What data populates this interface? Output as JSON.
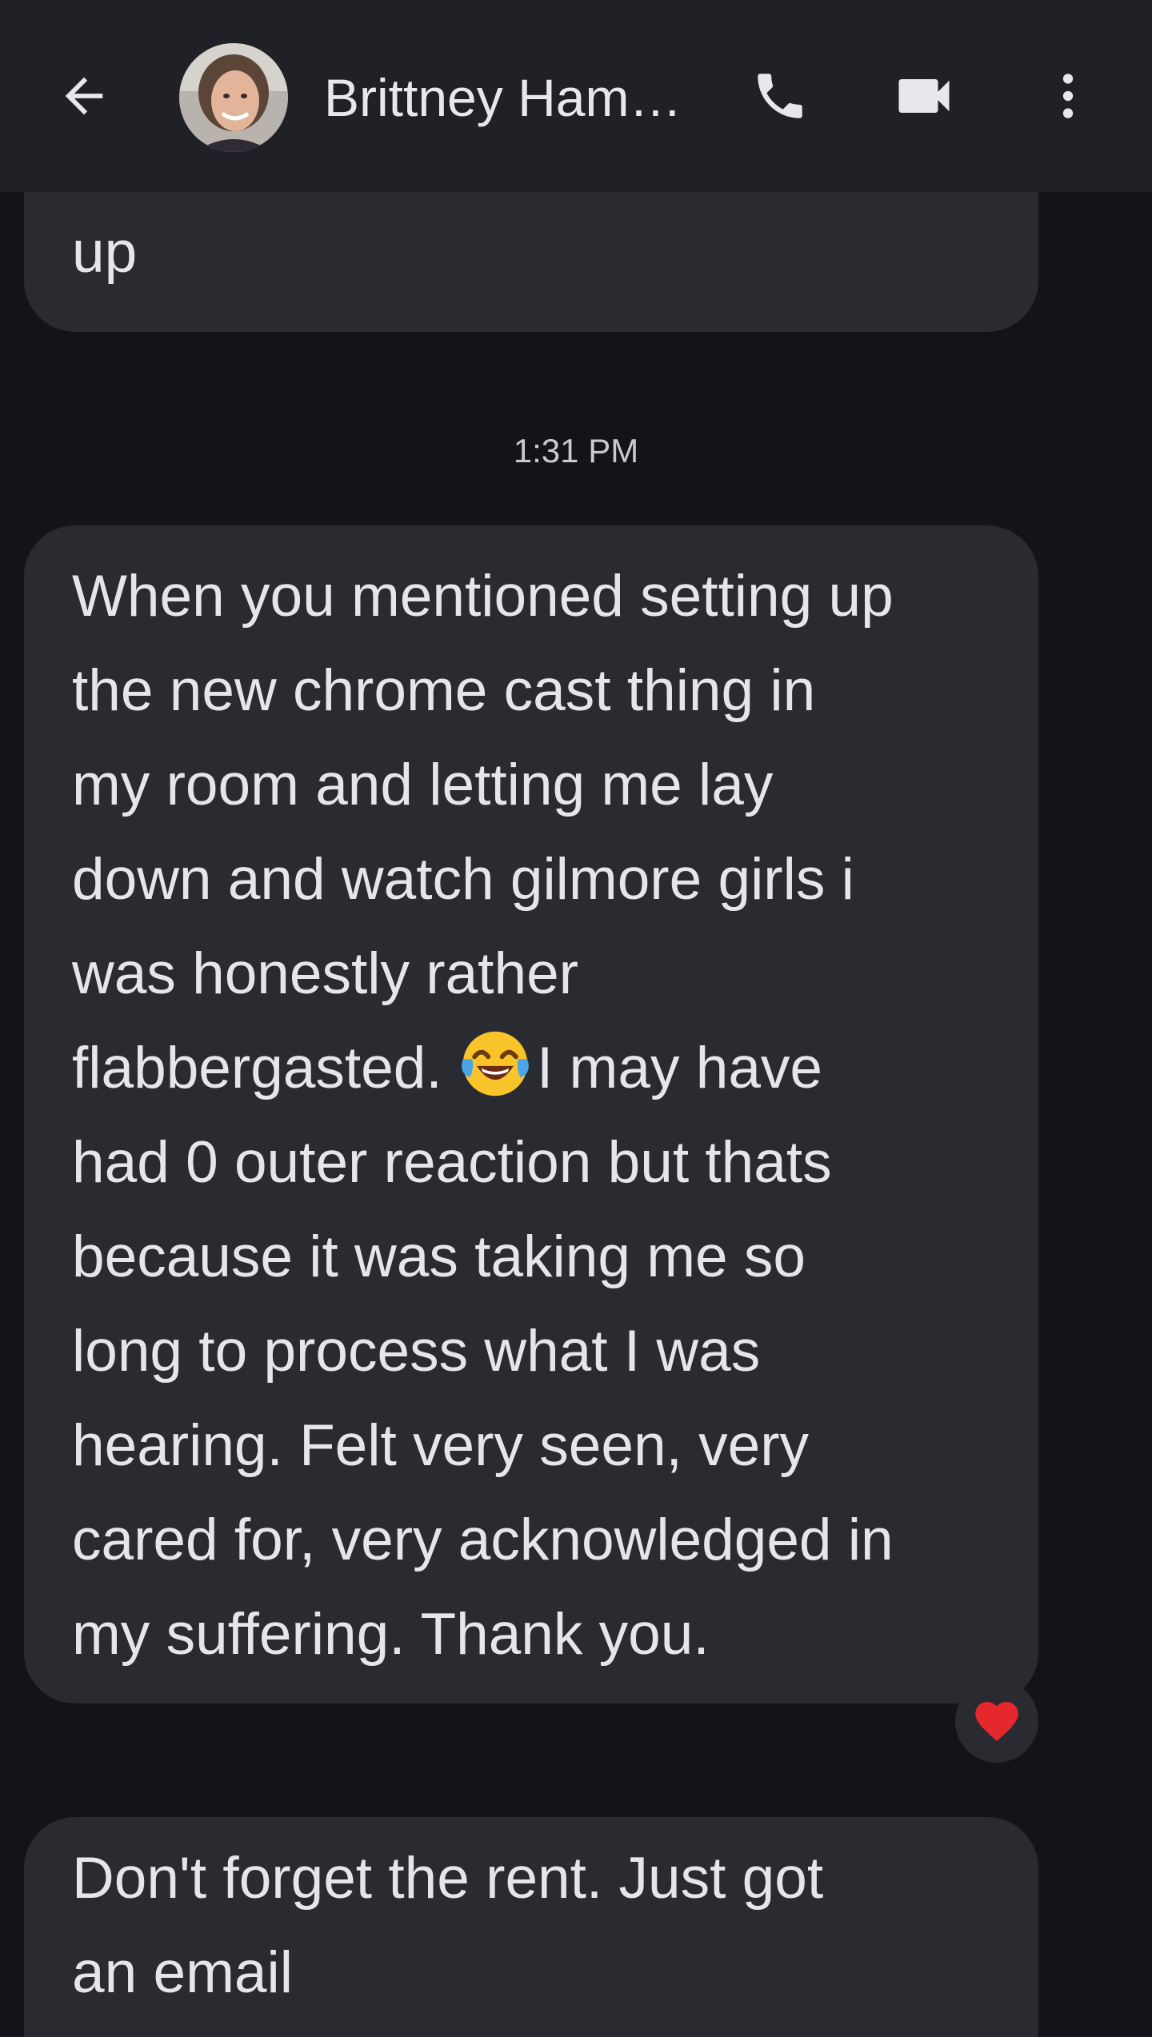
{
  "header": {
    "contact_name": "Brittney Ham…",
    "back_icon": "arrow-left-icon",
    "call_icon": "phone-icon",
    "video_icon": "video-camera-icon",
    "more_icon": "more-vert-icon"
  },
  "messages": [
    {
      "lines": [
        "up"
      ]
    },
    {
      "timestamp": "1:31 PM"
    },
    {
      "lines": [
        "When you mentioned setting up",
        "the new chrome cast thing in",
        "my room and letting me lay",
        "down and watch gilmore girls i",
        "was honestly rather",
        "flabbergasted.",
        "I may have",
        "had 0 outer reaction but thats",
        "because it was taking me so",
        "long to process what I was",
        "hearing. Felt very seen, very",
        "cared for, very acknowledged in",
        "my suffering. Thank you."
      ],
      "inline_emoji": "face-with-tears-of-joy",
      "reaction": "❤️"
    },
    {
      "lines": [
        "Don't forget the rent.  Just got",
        "an email"
      ]
    }
  ],
  "colors": {
    "background": "#131419",
    "header": "#202126",
    "bubble": "#2a2b31",
    "text": "#e6e6ea",
    "heart": "#e5282e"
  }
}
